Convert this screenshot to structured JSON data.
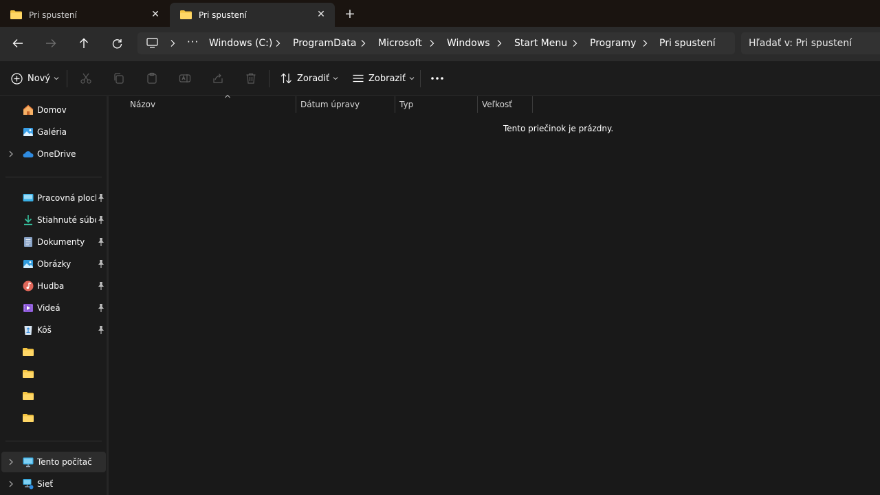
{
  "tabs": [
    {
      "label": "Pri spustení",
      "active": false
    },
    {
      "label": "Pri spustení",
      "active": true
    }
  ],
  "address": {
    "crumbs": [
      "Windows (C:)",
      "ProgramData",
      "Microsoft",
      "Windows",
      "Start Menu",
      "Programy",
      "Pri spustení"
    ],
    "search_placeholder": "Hľadať v: Pri spustení"
  },
  "toolbar": {
    "new_label": "Nový",
    "sort_label": "Zoradiť",
    "view_label": "Zobraziť"
  },
  "sidebar": {
    "top": [
      {
        "label": "Domov",
        "icon": "home-icon"
      },
      {
        "label": "Galéria",
        "icon": "gallery-icon"
      },
      {
        "label": "OneDrive",
        "icon": "cloud-icon"
      }
    ],
    "quick": [
      {
        "label": "Pracovná plocha",
        "icon": "desktop-icon"
      },
      {
        "label": "Stiahnuté súbory",
        "icon": "download-icon"
      },
      {
        "label": "Dokumenty",
        "icon": "document-icon"
      },
      {
        "label": "Obrázky",
        "icon": "pictures-icon"
      },
      {
        "label": "Hudba",
        "icon": "music-icon"
      },
      {
        "label": "Videá",
        "icon": "video-icon"
      },
      {
        "label": "Kôš",
        "icon": "recycle-bin-icon"
      }
    ],
    "bottom": [
      {
        "label": "Tento počítač",
        "icon": "computer-icon"
      },
      {
        "label": "Sieť",
        "icon": "network-icon"
      }
    ]
  },
  "columns": [
    "Názov",
    "Dátum úpravy",
    "Typ",
    "Veľkosť"
  ],
  "empty_message": "Tento priečinok je prázdny.",
  "colors": {
    "folder": "#f5c542",
    "accent": "#4cc2ff"
  }
}
